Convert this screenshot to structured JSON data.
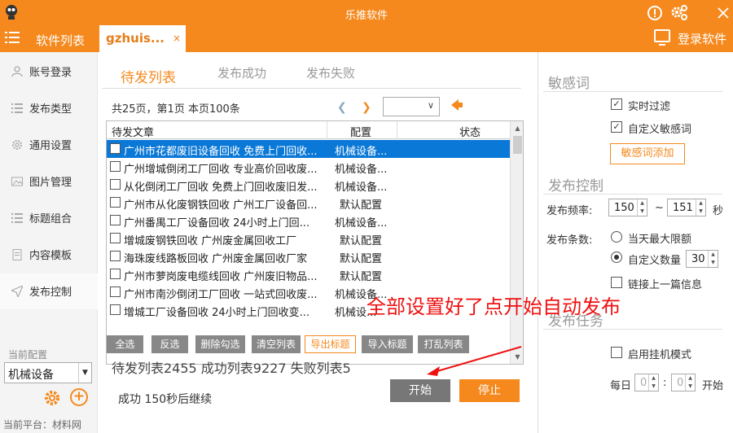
{
  "titlebar": {
    "title": "乐推软件",
    "icons": [
      "info-icon",
      "settings-icon",
      "close-icon"
    ]
  },
  "navbar": {
    "menu_label": "软件列表",
    "tab_label": "gzhuis...",
    "tab_close": "×",
    "login_label": "登录软件"
  },
  "sidebar": {
    "items": [
      {
        "label": "账号登录",
        "icon": "user-icon"
      },
      {
        "label": "发布类型",
        "icon": "list-icon"
      },
      {
        "label": "通用设置",
        "icon": "gear-icon"
      },
      {
        "label": "图片管理",
        "icon": "image-icon"
      },
      {
        "label": "标题组合",
        "icon": "list-icon"
      },
      {
        "label": "内容模板",
        "icon": "document-icon"
      },
      {
        "label": "发布控制",
        "icon": "send-icon"
      }
    ],
    "current_config_label": "当前配置",
    "current_config_value": "机械设备",
    "platform": "当前平台：材料网"
  },
  "main": {
    "tabs": [
      {
        "label": "待发列表",
        "active": true
      },
      {
        "label": "发布成功",
        "active": false
      },
      {
        "label": "发布失败",
        "active": false
      }
    ],
    "page_info": "共25页，第1页 本页100条",
    "table": {
      "headers": [
        "待发文章",
        "配置",
        "状态"
      ],
      "rows": [
        {
          "title": "广州市花都废旧设备回收 免费上门回收...",
          "config": "机械设备...",
          "status": "",
          "selected": true
        },
        {
          "title": "广州增城倒闭工厂回收 专业高价回收废...",
          "config": "机械设备...",
          "status": ""
        },
        {
          "title": "从化倒闭工厂回收 免费上门回收废旧发...",
          "config": "机械设备...",
          "status": ""
        },
        {
          "title": "广州市从化废钢铁回收 广州工厂设备回...",
          "config": "默认配置",
          "status": ""
        },
        {
          "title": "广州番禺工厂设备回收 24小时上门回...",
          "config": "机械设备...",
          "status": ""
        },
        {
          "title": "增城废钢铁回收 广州废金属回收工厂",
          "config": "默认配置",
          "status": ""
        },
        {
          "title": "海珠废线路板回收 广州废金属回收厂家",
          "config": "默认配置",
          "status": ""
        },
        {
          "title": "广州市萝岗废电缆线回收 广州废旧物品...",
          "config": "默认配置",
          "status": ""
        },
        {
          "title": "广州市南沙倒闭工厂回收 一站式回收废...",
          "config": "机械设备...",
          "status": ""
        },
        {
          "title": "增城工厂设备回收 24小时上门回收变...",
          "config": "机械设...",
          "status": ""
        }
      ]
    },
    "buttons": [
      "全选",
      "反选",
      "删除勾选",
      "清空列表",
      "导出标题",
      "导入标题",
      "打乱列表"
    ],
    "counts": "待发列表2455   成功列表9227   失败列表5",
    "status_line": "成功 150秒后继续",
    "start_label": "开始",
    "stop_label": "停止"
  },
  "right": {
    "sensitive_title": "敏感词",
    "realtime_filter": "实时过滤",
    "custom_sensitive": "自定义敏感词",
    "add_sensitive": "敏感词添加",
    "publish_control_title": "发布控制",
    "frequency_label": "发布频率:",
    "freq_min": "150",
    "freq_sep": "~",
    "freq_max": "151",
    "freq_unit": "秒",
    "count_label": "发布条数:",
    "opt_max": "当天最大限额",
    "opt_custom": "自定义数量",
    "custom_count": "30",
    "link_prev": "链接上一篇信息",
    "task_title": "发布任务",
    "hangup_mode": "启用挂机模式",
    "daily_label": "每日",
    "hour": "0",
    "colon": ":",
    "minute": "0",
    "start_suffix": "开始"
  },
  "annotation": {
    "text": "全部设置好了点开始自动发布",
    "color": "#e11111"
  },
  "colors": {
    "accent": "#f5891d",
    "selected_row": "#0a78d7"
  }
}
